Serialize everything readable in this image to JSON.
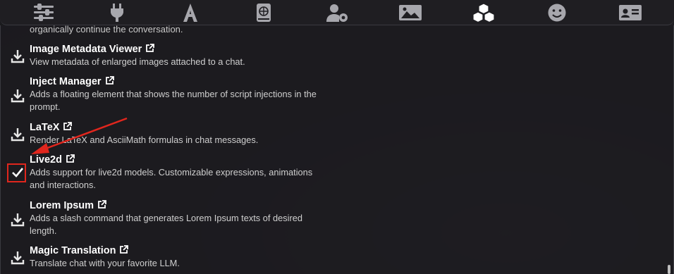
{
  "nav": {
    "icons": [
      "sliders-icon",
      "plug-icon",
      "font-icon",
      "book-globe-icon",
      "user-gear-icon",
      "image-icon",
      "cubes-icon",
      "smiley-icon",
      "id-card-icon"
    ]
  },
  "list": {
    "cutoff_text": "organically continue the conversation.",
    "items": [
      {
        "title": "Image Metadata Viewer",
        "description": "View metadata of enlarged images attached to a chat.",
        "status": "download"
      },
      {
        "title": "Inject Manager",
        "description": "Adds a floating element that shows the number of script injections in the prompt.",
        "status": "download"
      },
      {
        "title": "LaTeX",
        "description": "Render LaTeX and AsciiMath formulas in chat messages.",
        "status": "download"
      },
      {
        "title": "Live2d",
        "description": "Adds support for live2d models. Customizable expressions, animations and interactions.",
        "status": "installed"
      },
      {
        "title": "Lorem Ipsum",
        "description": "Adds a slash command that generates Lorem Ipsum texts of desired length.",
        "status": "download"
      },
      {
        "title": "Magic Translation",
        "description": "Translate chat with your favorite LLM.",
        "status": "download"
      }
    ]
  },
  "colors": {
    "annotation": "#e0261d",
    "accent_icon": "#a7a7ad"
  }
}
